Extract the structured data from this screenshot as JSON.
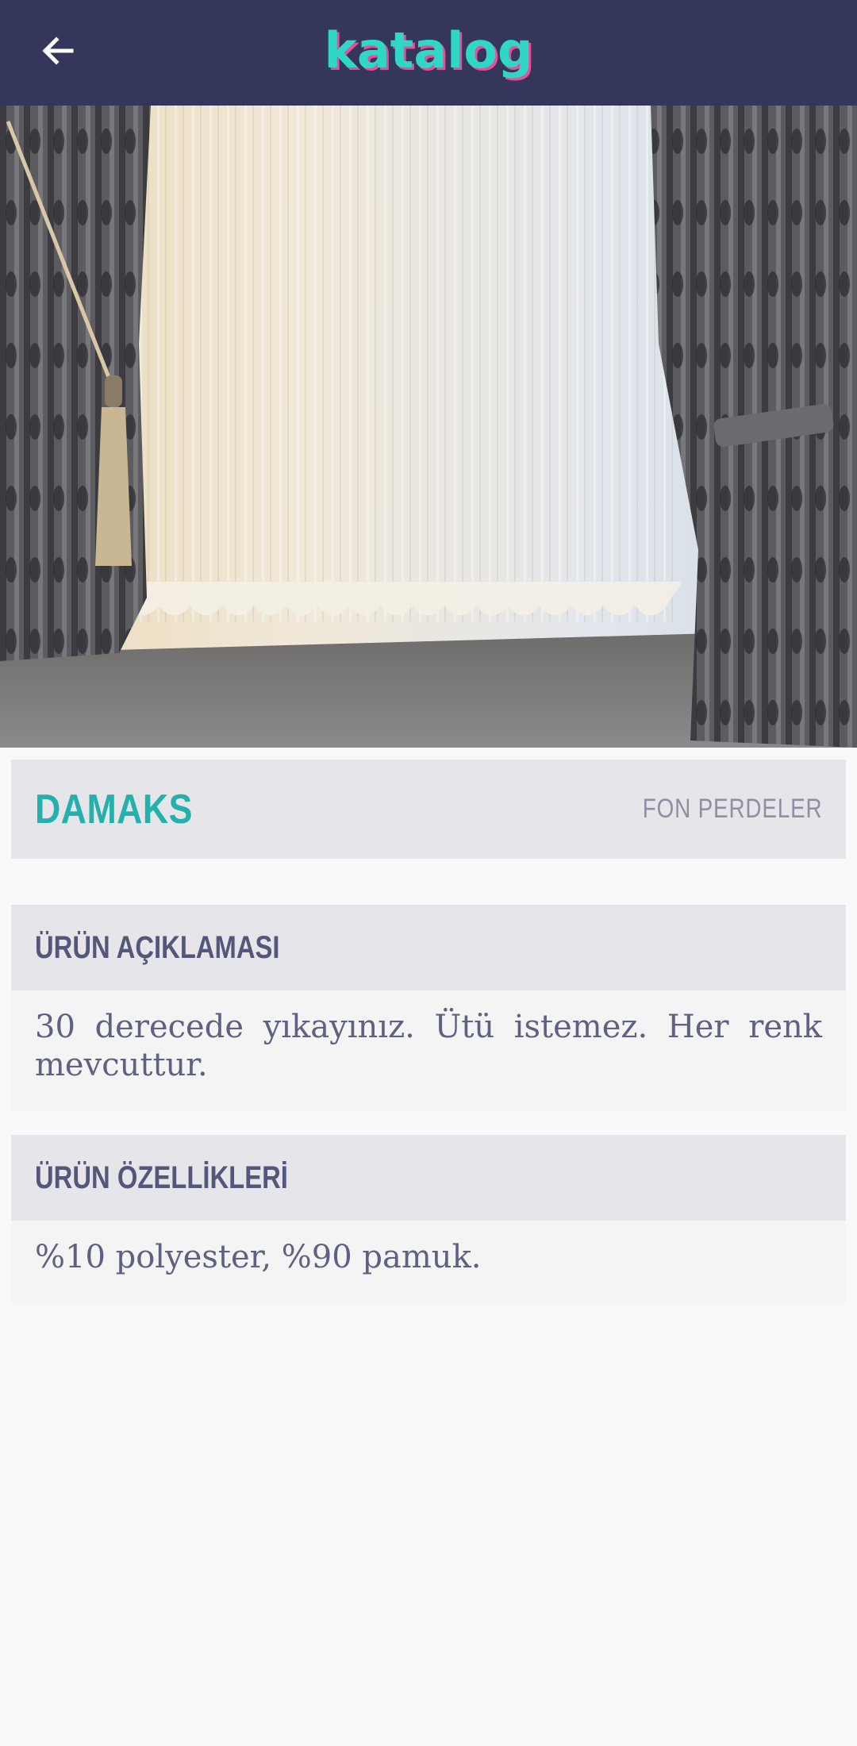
{
  "app_bar": {
    "logo_text": "katalog",
    "back_icon": "arrow-left-icon"
  },
  "product": {
    "name": "DAMAKS",
    "category": "FON PERDELER",
    "image_alt": "Curtain product photo"
  },
  "sections": {
    "description": {
      "header": "ÜRÜN AÇIKLAMASI",
      "body": "30 derecede yıkayınız. Ütü istemez. Her renk mevcuttur."
    },
    "features": {
      "header": "ÜRÜN ÖZELLİKLERİ",
      "body": "%10 polyester, %90 pamuk."
    }
  },
  "colors": {
    "app_bar": "#34365c",
    "logo_primary": "#2fd8c6",
    "logo_shadow": "#e94f96",
    "product_name": "#25b1ab",
    "text_muted": "#8f8fa2",
    "text_primary": "#55577a"
  }
}
